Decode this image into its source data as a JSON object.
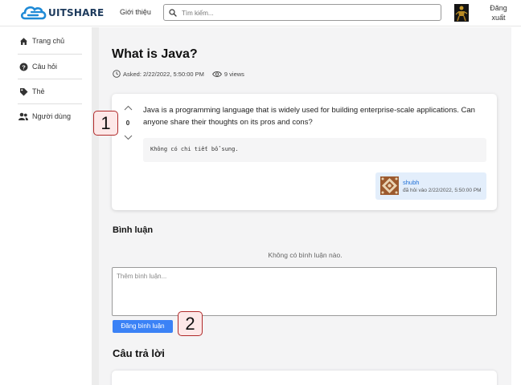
{
  "header": {
    "logo_text": "UITSHARE",
    "nav_intro": "Giới thiệu",
    "search_placeholder": "Tìm kiếm...",
    "logout_line1": "Đăng",
    "logout_line2": "xuất"
  },
  "sidebar": {
    "items": [
      {
        "label": "Trang chủ",
        "icon": "home-icon"
      },
      {
        "label": "Câu hỏi",
        "icon": "question-icon"
      },
      {
        "label": "Thẻ",
        "icon": "tag-icon"
      },
      {
        "label": "Người dùng",
        "icon": "users-icon"
      }
    ]
  },
  "question": {
    "title": "What is Java?",
    "asked": "Asked: 2/22/2022, 5:50:00 PM",
    "views": "9 views",
    "votes": "0",
    "body": "Java is a programming language that is widely used for building enterprise-scale applications. Can anyone share their thoughts on its pros and cons?",
    "detail": "Không có chi tiết bổ sung.",
    "author_name": "shubh",
    "author_time": "đã hỏi vào 2/22/2022, 5:50:00 PM"
  },
  "comments": {
    "title": "Bình luận",
    "empty_text": "Không có bình luận nào.",
    "placeholder": "Thêm bình luận...",
    "post_label": "Đăng bình luận"
  },
  "answers": {
    "title": "Câu trả lời"
  },
  "markers": [
    "1",
    "2"
  ],
  "colors": {
    "accent": "#3b82f6",
    "author_bg": "#e3eefb",
    "marker_bg": "#fde8e8",
    "marker_border": "#b02a2a"
  }
}
